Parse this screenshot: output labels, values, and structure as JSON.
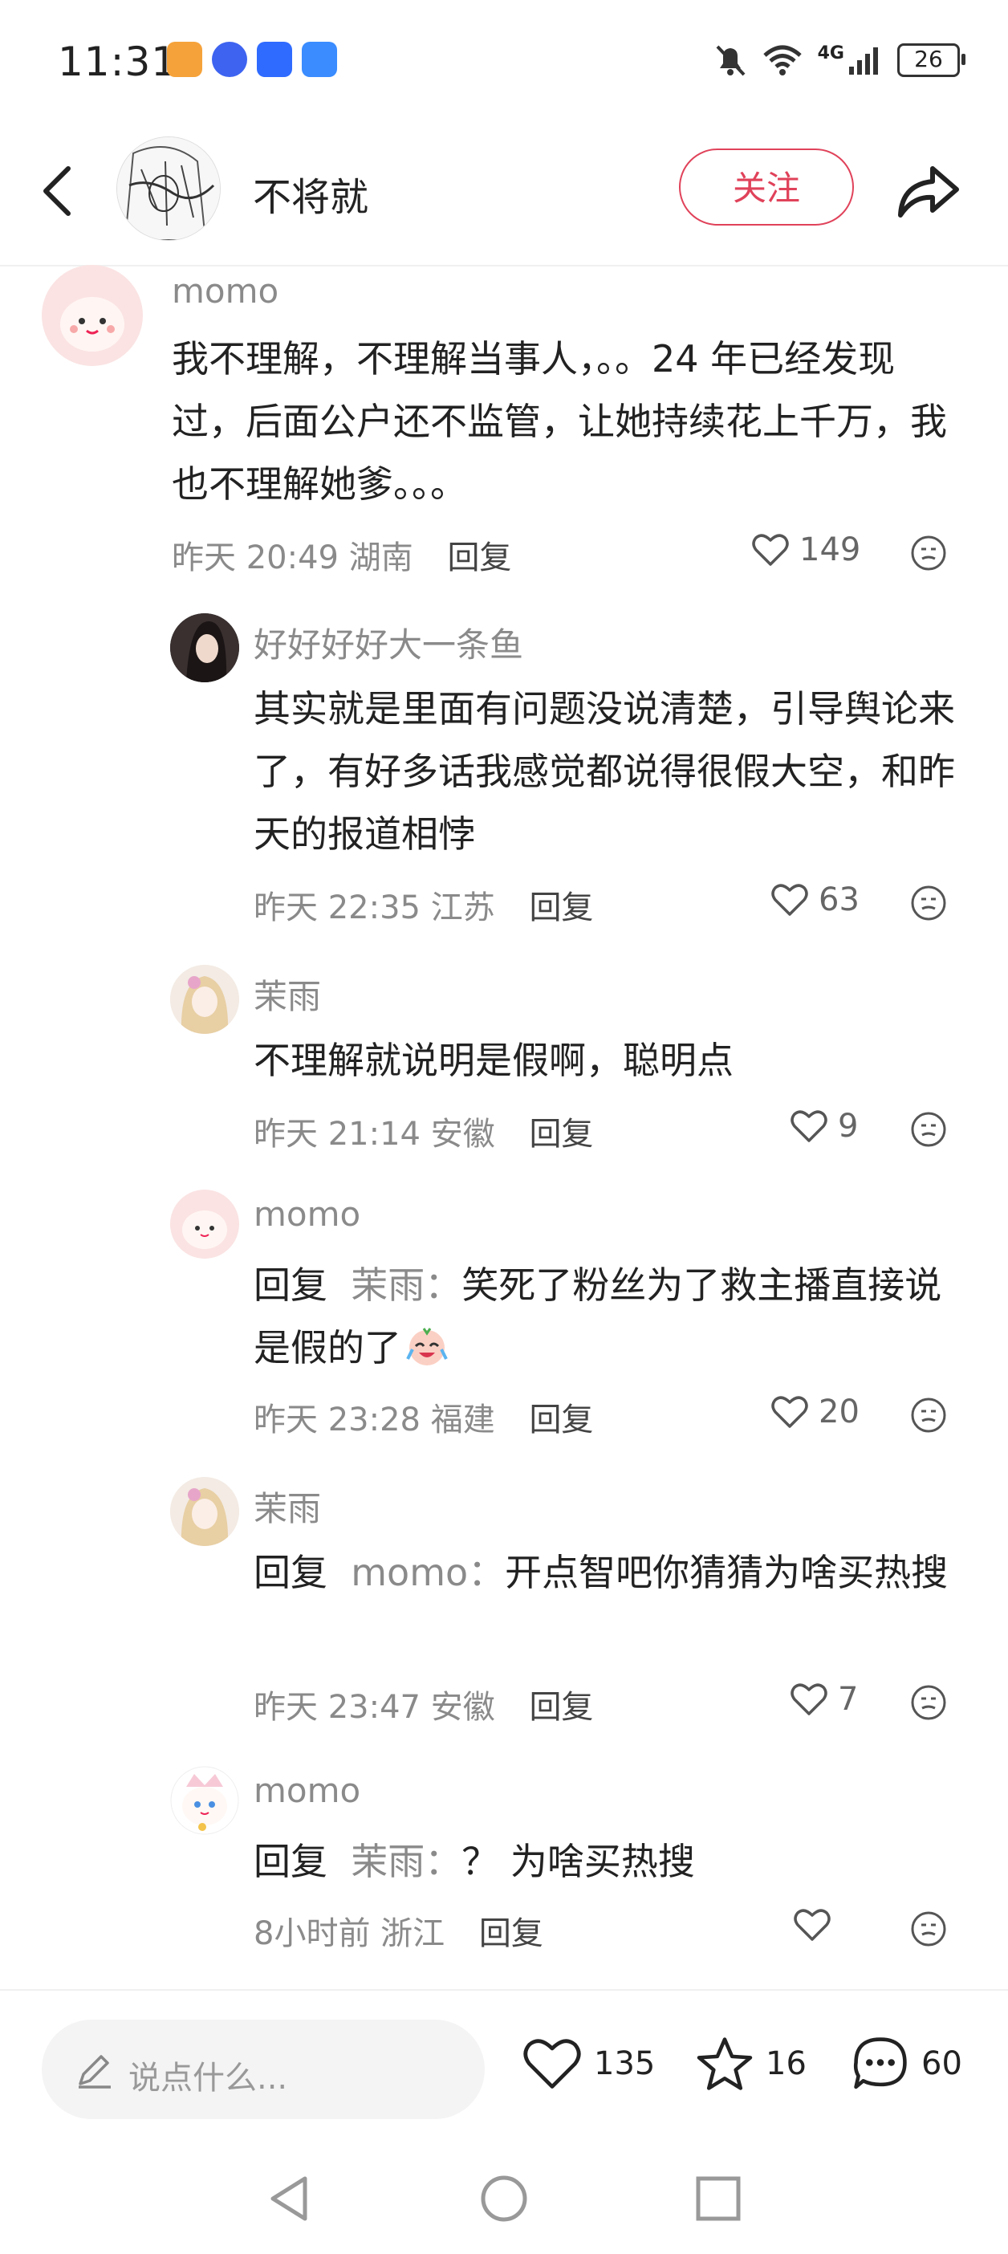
{
  "status_bar": {
    "time": "11:31",
    "network": "4G",
    "battery": "26"
  },
  "header": {
    "username": "不将就",
    "follow_label": "关注"
  },
  "comments": [
    {
      "username": "momo",
      "text": "我不理解，不理解当事人，。。24 年已经发现过，后面公户还不监管，让她持续花上千万，我也不理解她爹。。。",
      "time": "昨天 20:49",
      "location": "湖南",
      "reply_label": "回复",
      "likes": "149"
    },
    {
      "username": "好好好好大一条鱼",
      "text": "其实就是里面有问题没说清楚，引导舆论来了，有好多话我感觉都说得很假大空，和昨天的报道相悖",
      "time": "昨天 22:35",
      "location": "江苏",
      "reply_label": "回复",
      "likes": "63"
    },
    {
      "username": "茉雨",
      "text": "不理解就说明是假啊，聪明点",
      "time": "昨天 21:14",
      "location": "安徽",
      "reply_label": "回复",
      "likes": "9"
    },
    {
      "username": "momo",
      "reply_prefix": "回复",
      "reply_target": "茉雨",
      "text": "笑死了粉丝为了救主播直接说是假的了",
      "time": "昨天 23:28",
      "location": "福建",
      "reply_label": "回复",
      "likes": "20"
    },
    {
      "username": "茉雨",
      "reply_prefix": "回复",
      "reply_target": "momo",
      "text": "开点智吧你猜猜为啥买热搜",
      "time": "昨天 23:47",
      "location": "安徽",
      "reply_label": "回复",
      "likes": "7"
    },
    {
      "username": "momo",
      "reply_prefix": "回复",
      "reply_target": "茉雨",
      "text": "？ 为啥买热搜",
      "time": "8小时前",
      "location": "浙江",
      "reply_label": "回复",
      "likes": ""
    }
  ],
  "bottom_bar": {
    "input_placeholder": "说点什么...",
    "likes": "135",
    "favorites": "16",
    "comments": "60"
  },
  "colors": {
    "accent": "#e0425a",
    "muted": "#8a8a8a"
  }
}
